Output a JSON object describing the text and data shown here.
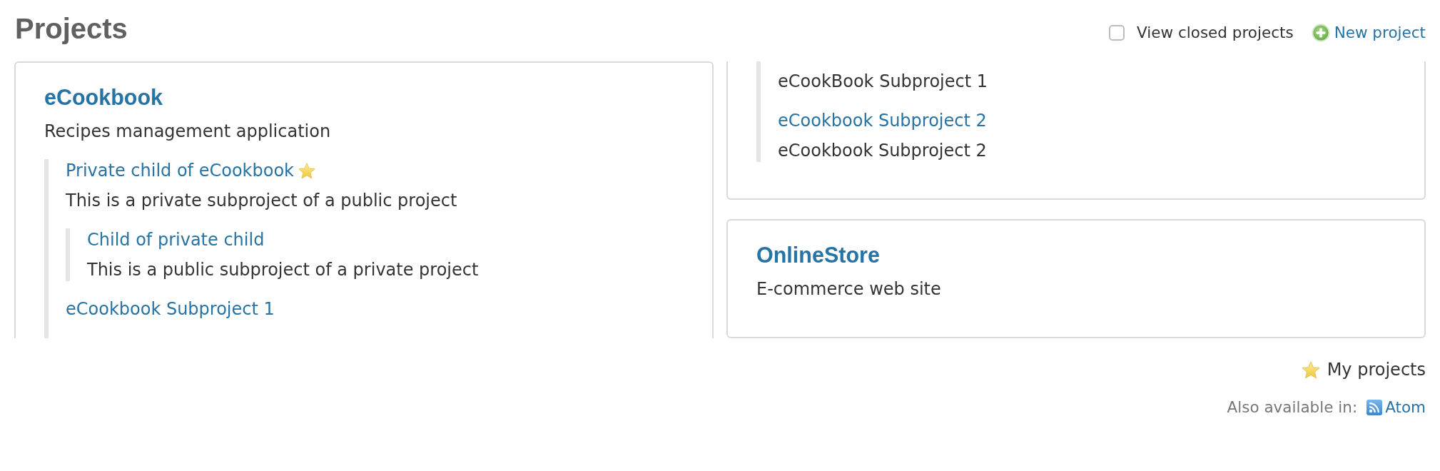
{
  "page": {
    "title": "Projects"
  },
  "view_closed": {
    "label": "View closed projects",
    "checked": false
  },
  "new_project": {
    "label": "New project"
  },
  "columns": [
    {
      "cards": [
        {
          "kind": "start",
          "name": "eCookbook",
          "my_project": false,
          "description": "Recipes management application",
          "children": [
            {
              "name": "Private child of eCookbook",
              "my_project": true,
              "description": "This is a private subproject of a public project",
              "children": [
                {
                  "name": "Child of private child",
                  "my_project": false,
                  "description": "This is a public subproject of a private project"
                }
              ]
            },
            {
              "name": "eCookbook Subproject 1",
              "my_project": false
            }
          ]
        }
      ]
    },
    {
      "cards": [
        {
          "kind": "end",
          "children": [
            {
              "description": "eCookBook Subproject 1"
            },
            {
              "name": "eCookbook Subproject 2",
              "my_project": false,
              "description": "eCookbook Subproject 2"
            }
          ]
        },
        {
          "kind": "whole",
          "name": "OnlineStore",
          "my_project": false,
          "description": "E-commerce web site"
        }
      ]
    }
  ],
  "legend": {
    "label": "My projects"
  },
  "other_formats": {
    "label": "Also available in:",
    "links": [
      {
        "label": "Atom"
      }
    ]
  }
}
